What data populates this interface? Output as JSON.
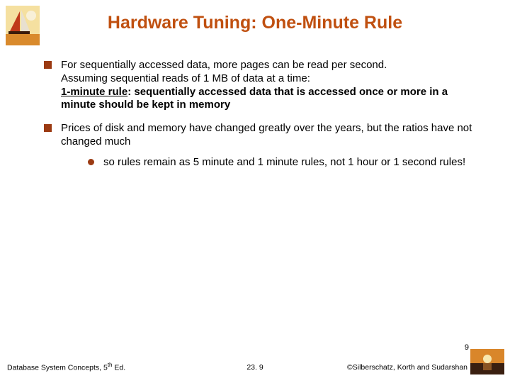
{
  "title": "Hardware Tuning: One-Minute Rule",
  "bullets": [
    {
      "line1": "For sequentially accessed data, more pages can be read per second.",
      "line2": "Assuming sequential reads of 1 MB of data at a time:",
      "rule_label": "1-minute rule",
      "rule_text": ": sequentially accessed data that is accessed once or more in  a minute should be kept in memory"
    },
    {
      "line1": "Prices of disk and memory have changed greatly over the years, but the ratios have not changed much",
      "sub": "so rules remain as 5 minute and 1 minute rules, not 1 hour or 1 second rules!"
    }
  ],
  "page_num": "9",
  "footer": {
    "left_a": "Database System Concepts, 5",
    "left_sup": "th",
    "left_b": " Ed.",
    "center": "23. 9",
    "right": "©Silberschatz, Korth and Sudarshan"
  }
}
